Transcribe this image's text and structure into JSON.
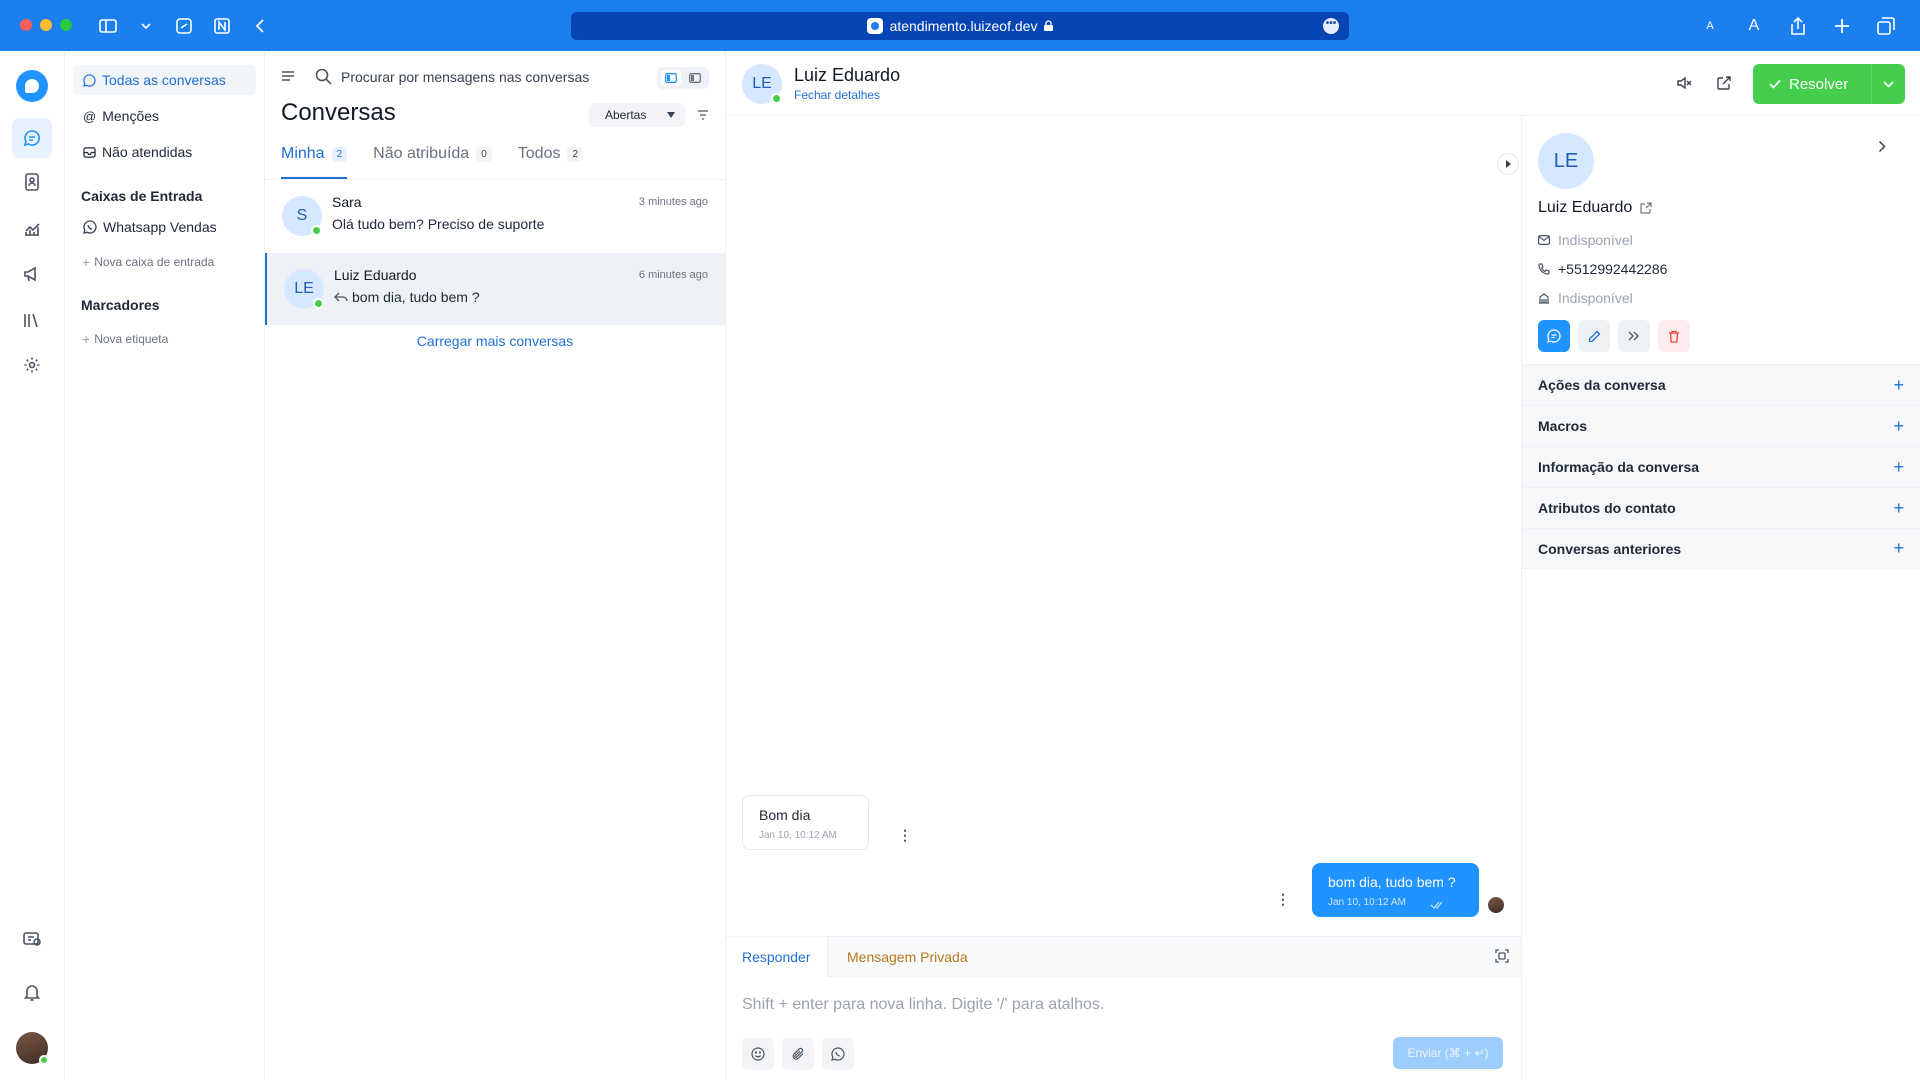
{
  "browser": {
    "url": "atendimento.luizeof.dev",
    "more": "•••"
  },
  "sidebar": {
    "items": [
      {
        "label": "Todas as conversas"
      },
      {
        "label": "Menções"
      },
      {
        "label": "Não atendidas"
      }
    ],
    "inboxes_heading": "Caixas de Entrada",
    "inboxes": [
      {
        "label": "Whatsapp Vendas"
      }
    ],
    "new_inbox": "Nova caixa de entrada",
    "labels_heading": "Marcadores",
    "new_label": "Nova etiqueta"
  },
  "list": {
    "search_placeholder": "Procurar por mensagens nas conversas",
    "title": "Conversas",
    "status_filter": "Abertas",
    "tabs": [
      {
        "label": "Minha",
        "count": "2"
      },
      {
        "label": "Não atribuída",
        "count": "0"
      },
      {
        "label": "Todos",
        "count": "2"
      }
    ],
    "conversations": [
      {
        "initials": "S",
        "name": "Sara",
        "time": "3 minutes ago",
        "message": "Olá tudo bem? Preciso de suporte"
      },
      {
        "initials": "LE",
        "name": "Luiz Eduardo",
        "time": "6 minutes ago",
        "message": "bom dia, tudo bem ?"
      }
    ],
    "load_more": "Carregar mais conversas"
  },
  "chat": {
    "initials": "LE",
    "name": "Luiz Eduardo",
    "subtitle": "Fechar detalhes",
    "resolve_label": "Resolver",
    "messages": [
      {
        "direction": "incoming",
        "text": "Bom dia",
        "time": "Jan 10, 10:12 AM"
      },
      {
        "direction": "outgoing",
        "text": "bom dia, tudo bem ?",
        "time": "Jan 10, 10:12 AM"
      }
    ],
    "composer": {
      "tab_reply": "Responder",
      "tab_private": "Mensagem Privada",
      "placeholder": "Shift + enter para nova linha. Digite '/' para atalhos.",
      "send_label": "Enviar (⌘ + ↵)"
    }
  },
  "contact": {
    "initials": "LE",
    "name": "Luiz Eduardo",
    "email": "Indisponível",
    "phone": "+5512992442286",
    "company": "Indisponível",
    "sections": [
      {
        "label": "Ações da conversa"
      },
      {
        "label": "Macros"
      },
      {
        "label": "Informação da conversa"
      },
      {
        "label": "Atributos do contato"
      },
      {
        "label": "Conversas anteriores"
      }
    ]
  },
  "colors": {
    "brand": "#1f93ff",
    "resolve": "#44ce4b",
    "browser_bar": "#1b7ff0",
    "danger": "#ef4444",
    "private_note": "#b8761c"
  }
}
